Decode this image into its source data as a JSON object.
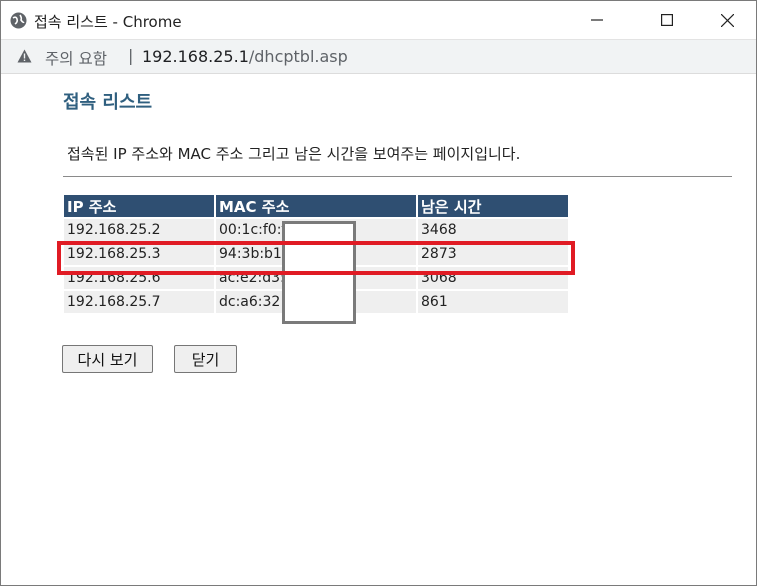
{
  "window": {
    "title": "접속 리스트 - Chrome"
  },
  "address_bar": {
    "security_label": "주의 요함",
    "separator": "|",
    "url_host": "192.168.25.1",
    "url_path": "/dhcptbl.asp"
  },
  "page": {
    "title": "접속 리스트",
    "description": "접속된 IP 주소와 MAC 주소 그리고 남은 시간을 보여주는 페이지입니다."
  },
  "table": {
    "headers": [
      "IP 주소",
      "MAC 주소",
      "남은 시간"
    ],
    "rows": [
      {
        "ip": "192.168.25.2",
        "mac": "00:1c:f0:f",
        "time": "3468"
      },
      {
        "ip": "192.168.25.3",
        "mac": "94:3b:b1",
        "time": "2873"
      },
      {
        "ip": "192.168.25.6",
        "mac": "ac:e2:d3:",
        "time": "3068"
      },
      {
        "ip": "192.168.25.7",
        "mac": "dc:a6:32:",
        "time": "861"
      }
    ]
  },
  "buttons": {
    "refresh": "다시 보기",
    "close": "닫기"
  },
  "colors": {
    "header_bg": "#2f4f72",
    "title_color": "#2f5f7f",
    "highlight": "#e01b24",
    "row_bg": "#efefef"
  },
  "icons": {
    "app": "globe-icon",
    "warning": "warning-triangle-icon",
    "minimize": "minimize-icon",
    "maximize": "maximize-icon",
    "close": "close-icon"
  }
}
